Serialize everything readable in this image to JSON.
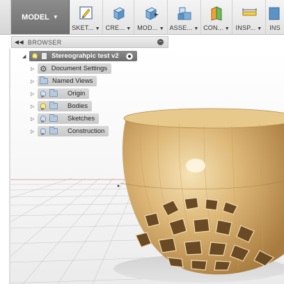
{
  "toolbar": {
    "workspace_label": "MODEL",
    "groups": [
      {
        "label": "SKET...",
        "icon": "sketch-icon"
      },
      {
        "label": "CRE...",
        "icon": "create-box-icon"
      },
      {
        "label": "MOD...",
        "icon": "modify-icon"
      },
      {
        "label": "ASSE...",
        "icon": "assemble-icon"
      },
      {
        "label": "CON...",
        "icon": "construct-plane-icon"
      },
      {
        "label": "INSP...",
        "icon": "inspect-measure-icon"
      },
      {
        "label": "INS",
        "icon": "insert-icon"
      }
    ]
  },
  "browser": {
    "title": "BROWSER",
    "root": "Stereograhpic test v2",
    "items": [
      {
        "label": "Document Settings",
        "icon": "gear-icon"
      },
      {
        "label": "Named Views",
        "icon": "folder-icon"
      },
      {
        "label": "Origin",
        "icon": "folder-icon"
      },
      {
        "label": "Bodies",
        "icon": "folder-icon"
      },
      {
        "label": "Sketches",
        "icon": "folder-icon"
      },
      {
        "label": "Construction",
        "icon": "folder-icon"
      }
    ]
  },
  "colors": {
    "wood_light": "#e8c98c",
    "wood_dark": "#b8894a",
    "workspace_button": "#7e7e7e"
  }
}
